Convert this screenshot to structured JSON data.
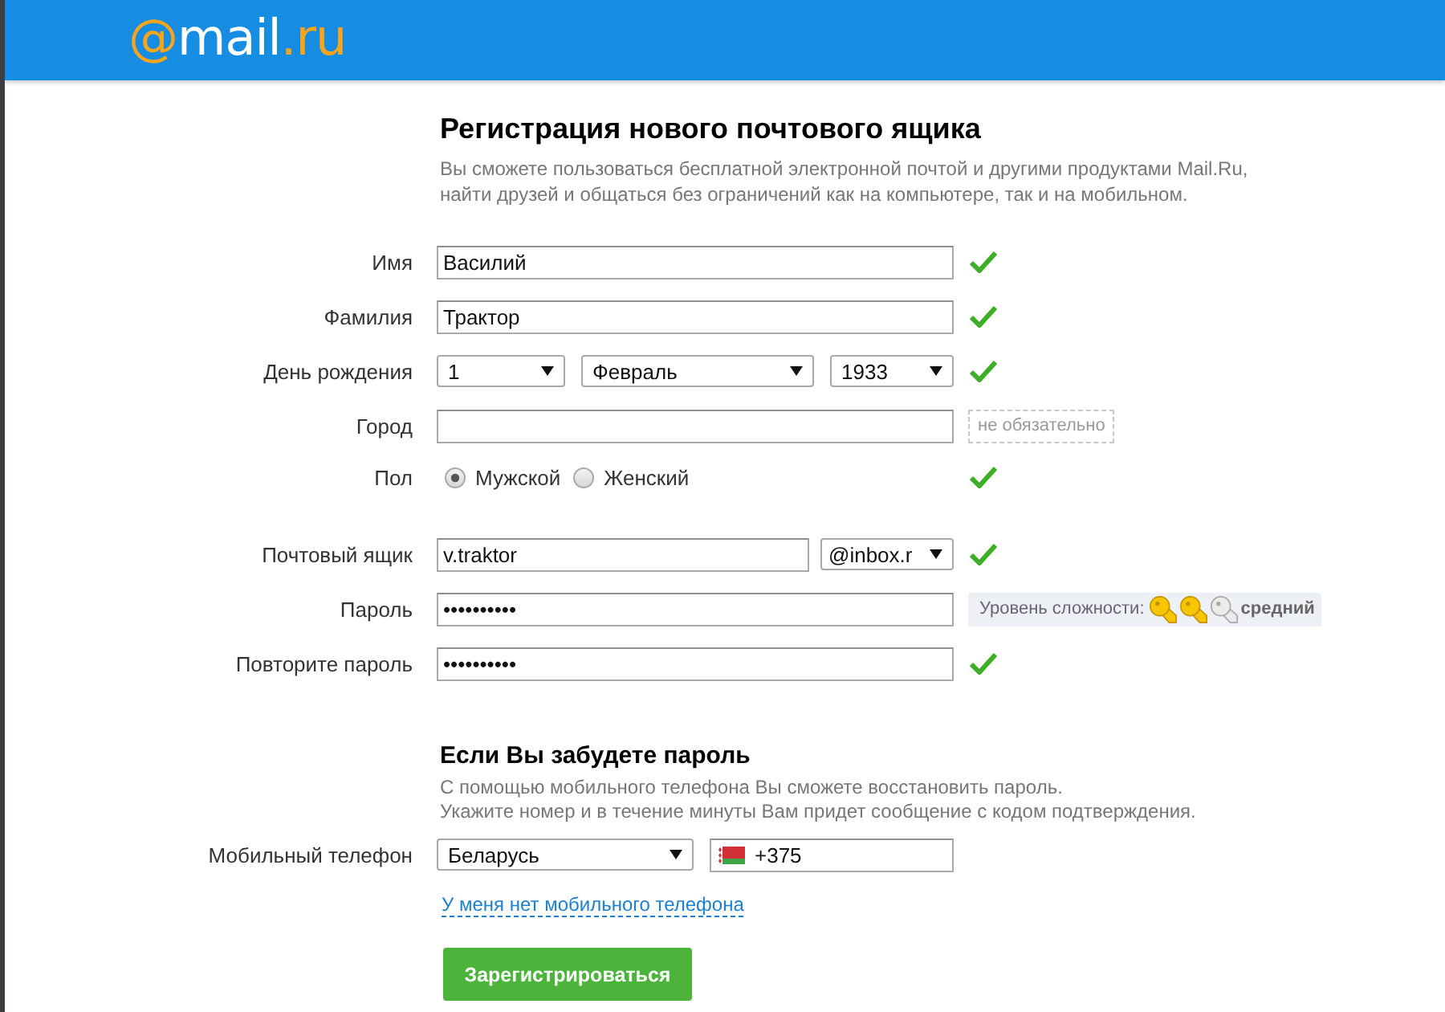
{
  "header": {
    "logo": [
      {
        "text": "@",
        "kind": "accent"
      },
      {
        "text": "mail",
        "kind": "plain"
      },
      {
        "text": ".ru",
        "kind": "accent"
      }
    ]
  },
  "intro": {
    "title": "Регистрация нового почтового ящика",
    "lines": [
      "Вы сможете пользоваться бесплатной электронной почтой и другими продуктами Mail.Ru,",
      "найти друзей и общаться без ограничений как на компьютере, так и на мобильном."
    ]
  },
  "personal": [
    {
      "kind": "text",
      "label": "Имя",
      "value": "Василий",
      "valid": true
    },
    {
      "kind": "text",
      "label": "Фамилия",
      "value": "Трактор",
      "valid": true
    },
    {
      "kind": "date",
      "label": "День рождения",
      "selects": [
        {
          "value": "1"
        },
        {
          "value": "Февраль"
        },
        {
          "value": "1933"
        }
      ],
      "valid": true
    },
    {
      "kind": "text",
      "label": "Город",
      "hint": "не обязательно"
    },
    {
      "kind": "radio",
      "label": "Пол",
      "options": [
        {
          "label": "Мужской",
          "selected": true
        },
        {
          "label": "Женский",
          "selected": false
        }
      ],
      "valid": true
    }
  ],
  "account": [
    {
      "kind": "mailbox",
      "label": "Почтовый ящик",
      "value": "v.traktor",
      "domain": "@inbox.r",
      "valid": true
    },
    {
      "kind": "password",
      "label": "Пароль",
      "value": "••••••••••",
      "strength": {
        "label": "Уровень сложности:",
        "stars": 2,
        "rating": "средний"
      }
    },
    {
      "kind": "password",
      "label": "Повторите пароль",
      "value": "••••••••••",
      "valid": true
    }
  ],
  "recovery": {
    "title": "Если Вы забудете пароль",
    "lines": [
      "С помощью мобильного телефона Вы сможете восстановить пароль.",
      "Укажите номер и в течение минуты Вам придет сообщение с кодом подтверждения."
    ],
    "phone": {
      "label": "Мобильный телефон",
      "country": "Беларусь",
      "value": "+375"
    },
    "no_phone_link": "У меня нет мобильного телефона"
  },
  "submit": {
    "label": "Зарегистрироваться"
  }
}
